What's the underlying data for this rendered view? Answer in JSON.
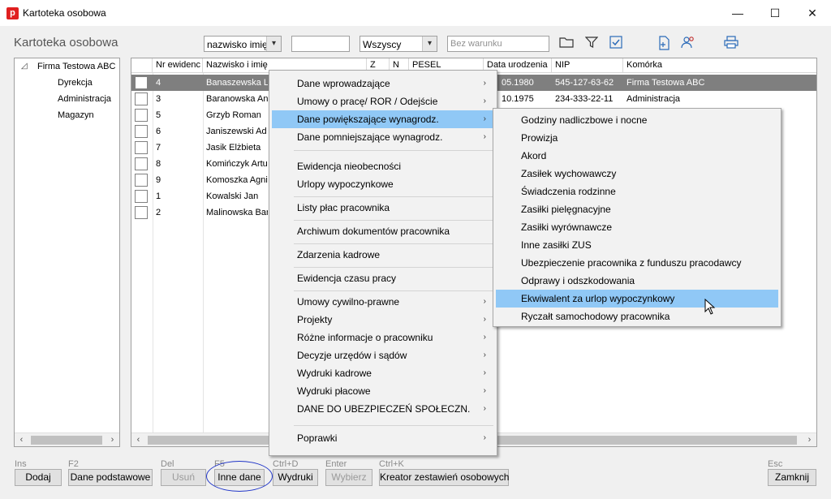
{
  "window": {
    "title": "Kartoteka osobowa",
    "app_icon_letter": "p",
    "controls": {
      "minimize": "—",
      "maximize": "☐",
      "close": "✕"
    }
  },
  "header": {
    "title": "Kartoteka osobowa",
    "sort_combo": "nazwisko imię",
    "search_value": "",
    "status_combo": "Wszyscy",
    "condition_placeholder": "Bez warunku"
  },
  "tree": {
    "root": "Firma Testowa ABC",
    "children": [
      "Dyrekcja",
      "Administracja",
      "Magazyn"
    ]
  },
  "grid": {
    "columns": [
      "Nr ewidenc",
      "Nazwisko i imię",
      "Z",
      "N",
      "PESEL",
      "Data urodzenia",
      "NIP",
      "Komórka"
    ],
    "rows": [
      {
        "nr": "4",
        "name": "Banaszewska L",
        "dob": "05.1980",
        "nip": "545-127-63-62",
        "unit": "Firma Testowa ABC"
      },
      {
        "nr": "3",
        "name": "Baranowska An",
        "dob": "10.1975",
        "nip": "234-333-22-11",
        "unit": "Administracja"
      },
      {
        "nr": "5",
        "name": "Grzyb Roman"
      },
      {
        "nr": "6",
        "name": "Janiszewski Ad"
      },
      {
        "nr": "7",
        "name": "Jasik Elżbieta"
      },
      {
        "nr": "8",
        "name": "Komińczyk Artur"
      },
      {
        "nr": "9",
        "name": "Komoszka Agnie"
      },
      {
        "nr": "1",
        "name": "Kowalski Jan"
      },
      {
        "nr": "2",
        "name": "Malinowska Bar"
      }
    ]
  },
  "context_menu": {
    "items": [
      {
        "label": "Dane wprowadzające",
        "submenu": true
      },
      {
        "label": "Umowy o pracę/ ROR / Odejście",
        "submenu": true
      },
      {
        "label": "Dane powiększające wynagrodz.",
        "submenu": true
      },
      {
        "label": "Dane pomniejszające wynagrodz.",
        "submenu": true
      },
      {
        "label": "Ewidencja nieobecności"
      },
      {
        "label": "Urlopy wypoczynkowe"
      },
      {
        "label": "Listy płac pracownika"
      },
      {
        "label": "Archiwum dokumentów pracownika"
      },
      {
        "label": "Zdarzenia kadrowe"
      },
      {
        "label": "Ewidencja czasu pracy"
      },
      {
        "label": "Umowy cywilno-prawne",
        "submenu": true
      },
      {
        "label": "Projekty",
        "submenu": true
      },
      {
        "label": "Różne informacje o pracowniku",
        "submenu": true
      },
      {
        "label": "Decyzje urzędów i sądów",
        "submenu": true
      },
      {
        "label": "Wydruki kadrowe",
        "submenu": true
      },
      {
        "label": "Wydruki płacowe",
        "submenu": true
      },
      {
        "label": "DANE DO UBEZPIECZEŃ SPOŁECZN.",
        "submenu": true
      },
      {
        "label": "Poprawki",
        "submenu": true
      }
    ],
    "arrow": "›"
  },
  "submenu": {
    "items": [
      "Godziny nadliczbowe i nocne",
      "Prowizja",
      "Akord",
      "Zasiłek wychowawczy",
      "Świadczenia rodzinne",
      "Zasiłki pielęgnacyjne",
      "Zasiłki wyrównawcze",
      "Inne zasiłki ZUS",
      "Ubezpieczenie pracownika z funduszu pracodawcy",
      "Odprawy i odszkodowania",
      "Ekwiwalent za urlop wypoczynkowy",
      "Ryczałt samochodowy pracownika"
    ]
  },
  "footer": {
    "keys": [
      "Ins",
      "F2",
      "Del",
      "F5",
      "Ctrl+D",
      "Enter",
      "Ctrl+K",
      "Esc"
    ],
    "buttons": [
      "Dodaj",
      "Dane podstawowe",
      "Usuń",
      "Inne dane",
      "Wydruki",
      "Wybierz",
      "Kreator zestawień osobowych",
      "Zamknij"
    ]
  },
  "colors": {
    "menu_highlight": "#90c8f6",
    "row_selected": "#7f7f7f",
    "annotation_circle": "#2035c8",
    "app_icon": "#e02020"
  }
}
